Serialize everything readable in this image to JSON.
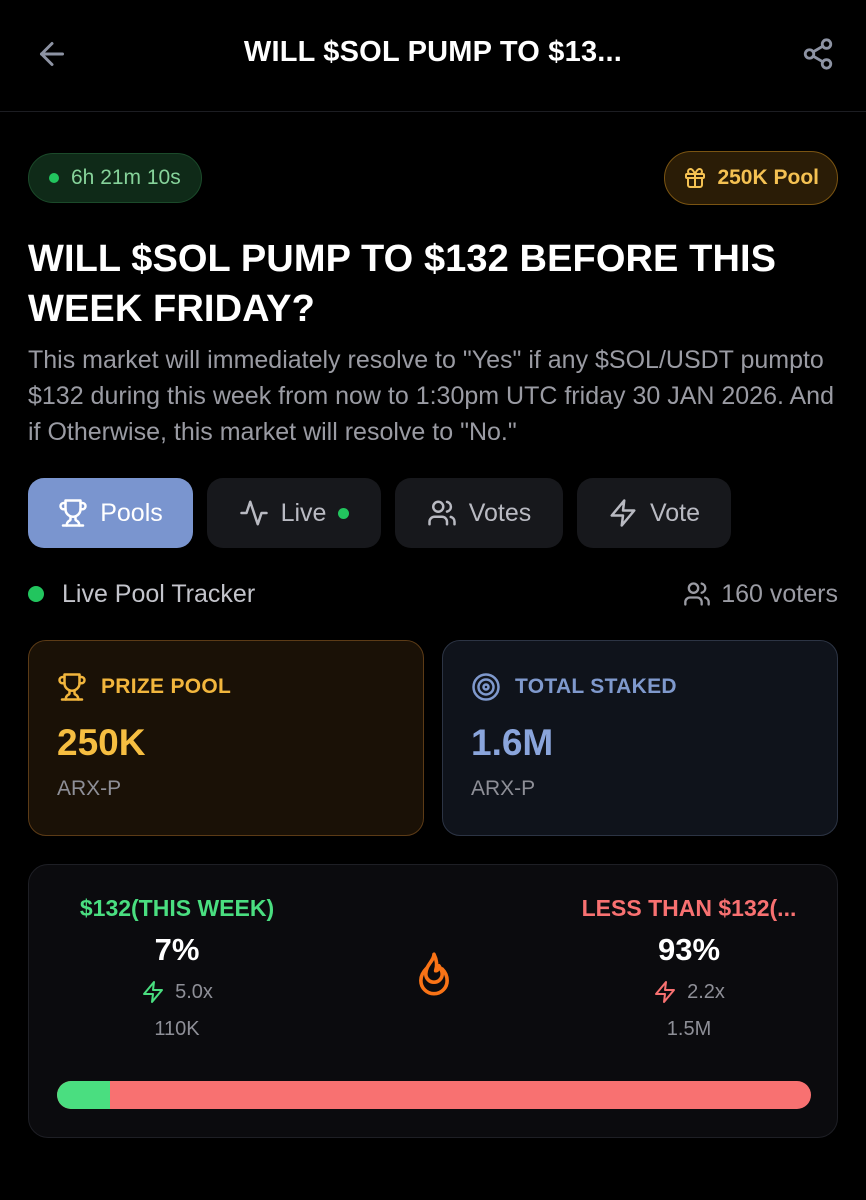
{
  "header": {
    "title": "WILL $SOL PUMP TO $13...",
    "back_icon": "arrow-left-icon",
    "share_icon": "share-icon"
  },
  "badges": {
    "timer": "6h 21m 10s",
    "pool": "250K Pool"
  },
  "market": {
    "title": "WILL $SOL PUMP TO $132 BEFORE THIS WEEK FRIDAY?",
    "description": "This market will immediately resolve to \"Yes\" if any $SOL/USDT pumpto $132 during this week from now to 1:30pm UTC friday 30 JAN 2026. And if Otherwise, this market will resolve to \"No.\""
  },
  "tabs": [
    {
      "label": "Pools",
      "icon": "trophy-icon",
      "active": true
    },
    {
      "label": "Live",
      "icon": "activity-icon",
      "active": false
    },
    {
      "label": "Votes",
      "icon": "users-icon",
      "active": false
    },
    {
      "label": "Vote",
      "icon": "lightning-icon",
      "active": false
    }
  ],
  "tracker": {
    "label": "Live Pool Tracker",
    "voters": "160 voters"
  },
  "stats": {
    "prize": {
      "label": "PRIZE POOL",
      "value": "250K",
      "unit": "ARX-P"
    },
    "staked": {
      "label": "TOTAL STAKED",
      "value": "1.6M",
      "unit": "ARX-P"
    }
  },
  "odds": {
    "yes": {
      "label": "$132(THIS WEEK)",
      "percent": "7%",
      "multiplier": "5.0x",
      "amount": "110K"
    },
    "no": {
      "label": "LESS THAN $132(...",
      "percent": "93%",
      "multiplier": "2.2x",
      "amount": "1.5M"
    },
    "yes_fraction": 0.07
  },
  "colors": {
    "accent": "#7a95cf",
    "green": "#4ade80",
    "red": "#f87171",
    "gold": "#f6be41"
  }
}
